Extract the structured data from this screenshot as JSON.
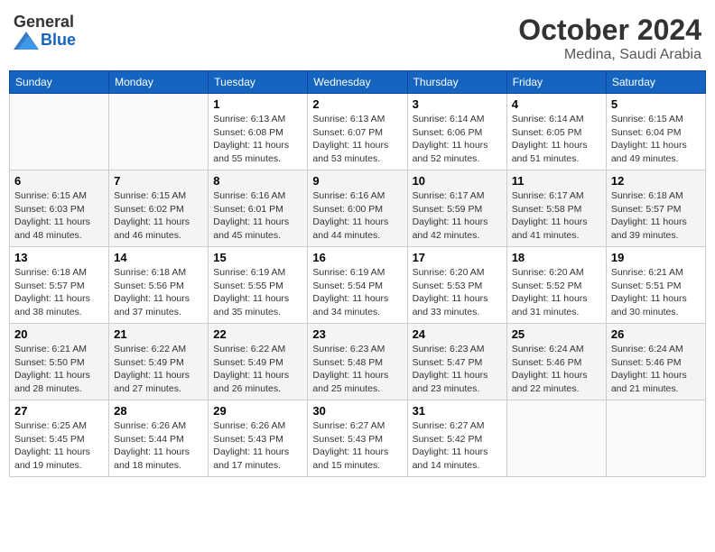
{
  "header": {
    "logo_general": "General",
    "logo_blue": "Blue",
    "title": "October 2024",
    "location": "Medina, Saudi Arabia"
  },
  "days_of_week": [
    "Sunday",
    "Monday",
    "Tuesday",
    "Wednesday",
    "Thursday",
    "Friday",
    "Saturday"
  ],
  "weeks": [
    [
      {
        "day": "",
        "sunrise": "",
        "sunset": "",
        "daylight": ""
      },
      {
        "day": "",
        "sunrise": "",
        "sunset": "",
        "daylight": ""
      },
      {
        "day": "1",
        "sunrise": "Sunrise: 6:13 AM",
        "sunset": "Sunset: 6:08 PM",
        "daylight": "Daylight: 11 hours and 55 minutes."
      },
      {
        "day": "2",
        "sunrise": "Sunrise: 6:13 AM",
        "sunset": "Sunset: 6:07 PM",
        "daylight": "Daylight: 11 hours and 53 minutes."
      },
      {
        "day": "3",
        "sunrise": "Sunrise: 6:14 AM",
        "sunset": "Sunset: 6:06 PM",
        "daylight": "Daylight: 11 hours and 52 minutes."
      },
      {
        "day": "4",
        "sunrise": "Sunrise: 6:14 AM",
        "sunset": "Sunset: 6:05 PM",
        "daylight": "Daylight: 11 hours and 51 minutes."
      },
      {
        "day": "5",
        "sunrise": "Sunrise: 6:15 AM",
        "sunset": "Sunset: 6:04 PM",
        "daylight": "Daylight: 11 hours and 49 minutes."
      }
    ],
    [
      {
        "day": "6",
        "sunrise": "Sunrise: 6:15 AM",
        "sunset": "Sunset: 6:03 PM",
        "daylight": "Daylight: 11 hours and 48 minutes."
      },
      {
        "day": "7",
        "sunrise": "Sunrise: 6:15 AM",
        "sunset": "Sunset: 6:02 PM",
        "daylight": "Daylight: 11 hours and 46 minutes."
      },
      {
        "day": "8",
        "sunrise": "Sunrise: 6:16 AM",
        "sunset": "Sunset: 6:01 PM",
        "daylight": "Daylight: 11 hours and 45 minutes."
      },
      {
        "day": "9",
        "sunrise": "Sunrise: 6:16 AM",
        "sunset": "Sunset: 6:00 PM",
        "daylight": "Daylight: 11 hours and 44 minutes."
      },
      {
        "day": "10",
        "sunrise": "Sunrise: 6:17 AM",
        "sunset": "Sunset: 5:59 PM",
        "daylight": "Daylight: 11 hours and 42 minutes."
      },
      {
        "day": "11",
        "sunrise": "Sunrise: 6:17 AM",
        "sunset": "Sunset: 5:58 PM",
        "daylight": "Daylight: 11 hours and 41 minutes."
      },
      {
        "day": "12",
        "sunrise": "Sunrise: 6:18 AM",
        "sunset": "Sunset: 5:57 PM",
        "daylight": "Daylight: 11 hours and 39 minutes."
      }
    ],
    [
      {
        "day": "13",
        "sunrise": "Sunrise: 6:18 AM",
        "sunset": "Sunset: 5:57 PM",
        "daylight": "Daylight: 11 hours and 38 minutes."
      },
      {
        "day": "14",
        "sunrise": "Sunrise: 6:18 AM",
        "sunset": "Sunset: 5:56 PM",
        "daylight": "Daylight: 11 hours and 37 minutes."
      },
      {
        "day": "15",
        "sunrise": "Sunrise: 6:19 AM",
        "sunset": "Sunset: 5:55 PM",
        "daylight": "Daylight: 11 hours and 35 minutes."
      },
      {
        "day": "16",
        "sunrise": "Sunrise: 6:19 AM",
        "sunset": "Sunset: 5:54 PM",
        "daylight": "Daylight: 11 hours and 34 minutes."
      },
      {
        "day": "17",
        "sunrise": "Sunrise: 6:20 AM",
        "sunset": "Sunset: 5:53 PM",
        "daylight": "Daylight: 11 hours and 33 minutes."
      },
      {
        "day": "18",
        "sunrise": "Sunrise: 6:20 AM",
        "sunset": "Sunset: 5:52 PM",
        "daylight": "Daylight: 11 hours and 31 minutes."
      },
      {
        "day": "19",
        "sunrise": "Sunrise: 6:21 AM",
        "sunset": "Sunset: 5:51 PM",
        "daylight": "Daylight: 11 hours and 30 minutes."
      }
    ],
    [
      {
        "day": "20",
        "sunrise": "Sunrise: 6:21 AM",
        "sunset": "Sunset: 5:50 PM",
        "daylight": "Daylight: 11 hours and 28 minutes."
      },
      {
        "day": "21",
        "sunrise": "Sunrise: 6:22 AM",
        "sunset": "Sunset: 5:49 PM",
        "daylight": "Daylight: 11 hours and 27 minutes."
      },
      {
        "day": "22",
        "sunrise": "Sunrise: 6:22 AM",
        "sunset": "Sunset: 5:49 PM",
        "daylight": "Daylight: 11 hours and 26 minutes."
      },
      {
        "day": "23",
        "sunrise": "Sunrise: 6:23 AM",
        "sunset": "Sunset: 5:48 PM",
        "daylight": "Daylight: 11 hours and 25 minutes."
      },
      {
        "day": "24",
        "sunrise": "Sunrise: 6:23 AM",
        "sunset": "Sunset: 5:47 PM",
        "daylight": "Daylight: 11 hours and 23 minutes."
      },
      {
        "day": "25",
        "sunrise": "Sunrise: 6:24 AM",
        "sunset": "Sunset: 5:46 PM",
        "daylight": "Daylight: 11 hours and 22 minutes."
      },
      {
        "day": "26",
        "sunrise": "Sunrise: 6:24 AM",
        "sunset": "Sunset: 5:46 PM",
        "daylight": "Daylight: 11 hours and 21 minutes."
      }
    ],
    [
      {
        "day": "27",
        "sunrise": "Sunrise: 6:25 AM",
        "sunset": "Sunset: 5:45 PM",
        "daylight": "Daylight: 11 hours and 19 minutes."
      },
      {
        "day": "28",
        "sunrise": "Sunrise: 6:26 AM",
        "sunset": "Sunset: 5:44 PM",
        "daylight": "Daylight: 11 hours and 18 minutes."
      },
      {
        "day": "29",
        "sunrise": "Sunrise: 6:26 AM",
        "sunset": "Sunset: 5:43 PM",
        "daylight": "Daylight: 11 hours and 17 minutes."
      },
      {
        "day": "30",
        "sunrise": "Sunrise: 6:27 AM",
        "sunset": "Sunset: 5:43 PM",
        "daylight": "Daylight: 11 hours and 15 minutes."
      },
      {
        "day": "31",
        "sunrise": "Sunrise: 6:27 AM",
        "sunset": "Sunset: 5:42 PM",
        "daylight": "Daylight: 11 hours and 14 minutes."
      },
      {
        "day": "",
        "sunrise": "",
        "sunset": "",
        "daylight": ""
      },
      {
        "day": "",
        "sunrise": "",
        "sunset": "",
        "daylight": ""
      }
    ]
  ]
}
